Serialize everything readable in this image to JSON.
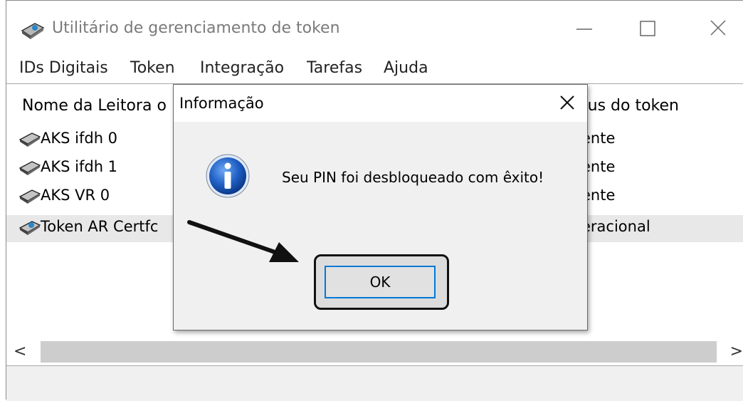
{
  "window": {
    "title": "Utilitário de gerenciamento de token",
    "minimize_label": "—",
    "maximize_label": "☐",
    "close_label": "✕"
  },
  "menu": [
    "IDs Digitais",
    "Token",
    "Integração",
    "Tarefas",
    "Ajuda"
  ],
  "list": {
    "columns": {
      "name": "Nome da Leitora o",
      "status": "tus do token"
    },
    "rows": [
      {
        "name": "AKS ifdh 0",
        "status": "ente",
        "icon": "card-reader-icon"
      },
      {
        "name": "AKS ifdh 1",
        "status": "ente",
        "icon": "card-reader-icon"
      },
      {
        "name": "AKS VR 0",
        "status": "ente",
        "icon": "card-reader-icon"
      },
      {
        "name": "Token AR Certfc",
        "status": "eracional",
        "icon": "token-reader-icon",
        "selected": true
      }
    ]
  },
  "scrollbar": {
    "left": "<",
    "right": ">"
  },
  "dialog": {
    "title": "Informação",
    "close_label": "✕",
    "message": "Seu PIN foi desbloqueado com êxito!",
    "ok_label": "OK",
    "icon": "info-icon"
  },
  "colors": {
    "focus_border": "#0078d7",
    "info_blue": "#1f5fc4"
  }
}
